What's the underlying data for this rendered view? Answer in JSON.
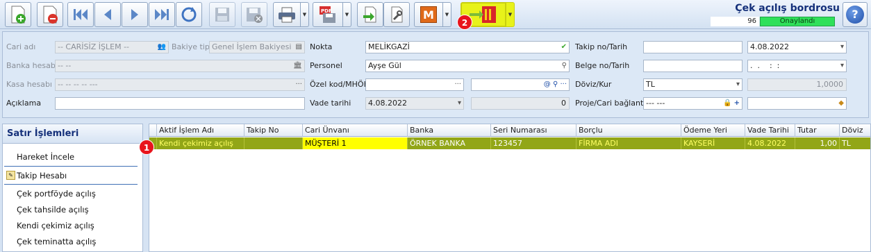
{
  "toolbar": {
    "buttons": [
      "new-icon",
      "delete-icon",
      "first-icon",
      "prev-icon",
      "next-icon",
      "last-icon",
      "refresh-icon",
      "save-icon",
      "save-close-icon",
      "print-icon",
      "pdf-icon",
      "import-icon",
      "tools-icon",
      "m-icon",
      "transfer-icon"
    ]
  },
  "header": {
    "title": "Çek açılış bordrosu",
    "doc_no": "96",
    "status": "Onaylandı"
  },
  "badges": {
    "one": "1",
    "two": "2"
  },
  "form": {
    "cari_adi": {
      "label": "Cari adı",
      "value": "-- CARİSİZ İŞLEM --"
    },
    "bakiye_tipi": {
      "label": "Bakiye tipi",
      "value": "Genel İşlem Bakiyesi"
    },
    "banka_hesabi": {
      "label": "Banka hesabı",
      "value": "-- --"
    },
    "kasa_hesabi": {
      "label": "Kasa hesabı",
      "value": "-- -- -- -- ---"
    },
    "aciklama": {
      "label": "Açıklama",
      "value": ""
    },
    "nokta": {
      "label": "Nokta",
      "value": "MELİKGAZİ"
    },
    "personel": {
      "label": "Personel",
      "value": "Ayşe Gül"
    },
    "ozel_kod": {
      "label": "Özel kod/MHÖK",
      "value": "",
      "value2": ""
    },
    "vade_tarihi": {
      "label": "Vade tarihi",
      "value": "4.08.2022",
      "value2": "0"
    },
    "takip_no": {
      "label": "Takip no/Tarih",
      "value": "",
      "date": "4.08.2022"
    },
    "belge_no": {
      "label": "Belge no/Tarih",
      "value": "",
      "date": ".  .    :  :"
    },
    "doviz_kur": {
      "label": "Döviz/Kur",
      "value": "TL",
      "rate": "1,0000"
    },
    "proje": {
      "label": "Proje/Cari bağlantı",
      "value": "--- ---",
      "value2": ""
    }
  },
  "panel": {
    "title": "Satır İşlemleri",
    "items": [
      "Hareket İncele",
      "Takip Hesabı",
      "Çek portföyde açılış",
      "Çek tahsilde açılış",
      "Kendi çekimiz açılış",
      "Çek teminatta açılış"
    ]
  },
  "grid": {
    "columns": [
      "Aktif İşlem Adı",
      "Takip No",
      "Cari Ünvanı",
      "Banka",
      "Seri Numarası",
      "Borçlu",
      "Ödeme Yeri",
      "Vade Tarihi",
      "Tutar",
      "Döviz"
    ],
    "rows": [
      [
        "Kendi çekimiz açılış",
        "",
        "MÜŞTERİ 1",
        "ÖRNEK BANKA",
        "123457",
        "FİRMA ADI",
        "KAYSERİ",
        "4.08.2022",
        "1,00",
        "TL"
      ]
    ]
  }
}
